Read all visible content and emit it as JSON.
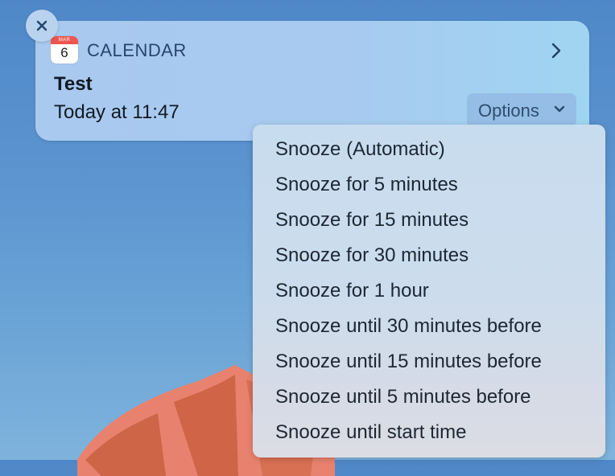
{
  "notification": {
    "app_icon": {
      "month": "MAR",
      "day": "6"
    },
    "app_name": "CALENDAR",
    "title": "Test",
    "subtitle": "Today at 11:47",
    "options_label": "Options"
  },
  "menu": {
    "items": [
      "Snooze (Automatic)",
      "Snooze for 5 minutes",
      "Snooze for 15 minutes",
      "Snooze for 30 minutes",
      "Snooze for 1 hour",
      "Snooze until 30 minutes before",
      "Snooze until 15 minutes before",
      "Snooze until 5 minutes before",
      "Snooze until start time"
    ]
  },
  "icons": {
    "close": "close-icon",
    "expand": "chevron-right-icon",
    "dropdown": "chevron-down-icon",
    "app": "calendar-app-icon"
  },
  "colors": {
    "calendar_band": "#ec5550",
    "app_name": "#26466c",
    "menu_text": "#1d2733"
  }
}
